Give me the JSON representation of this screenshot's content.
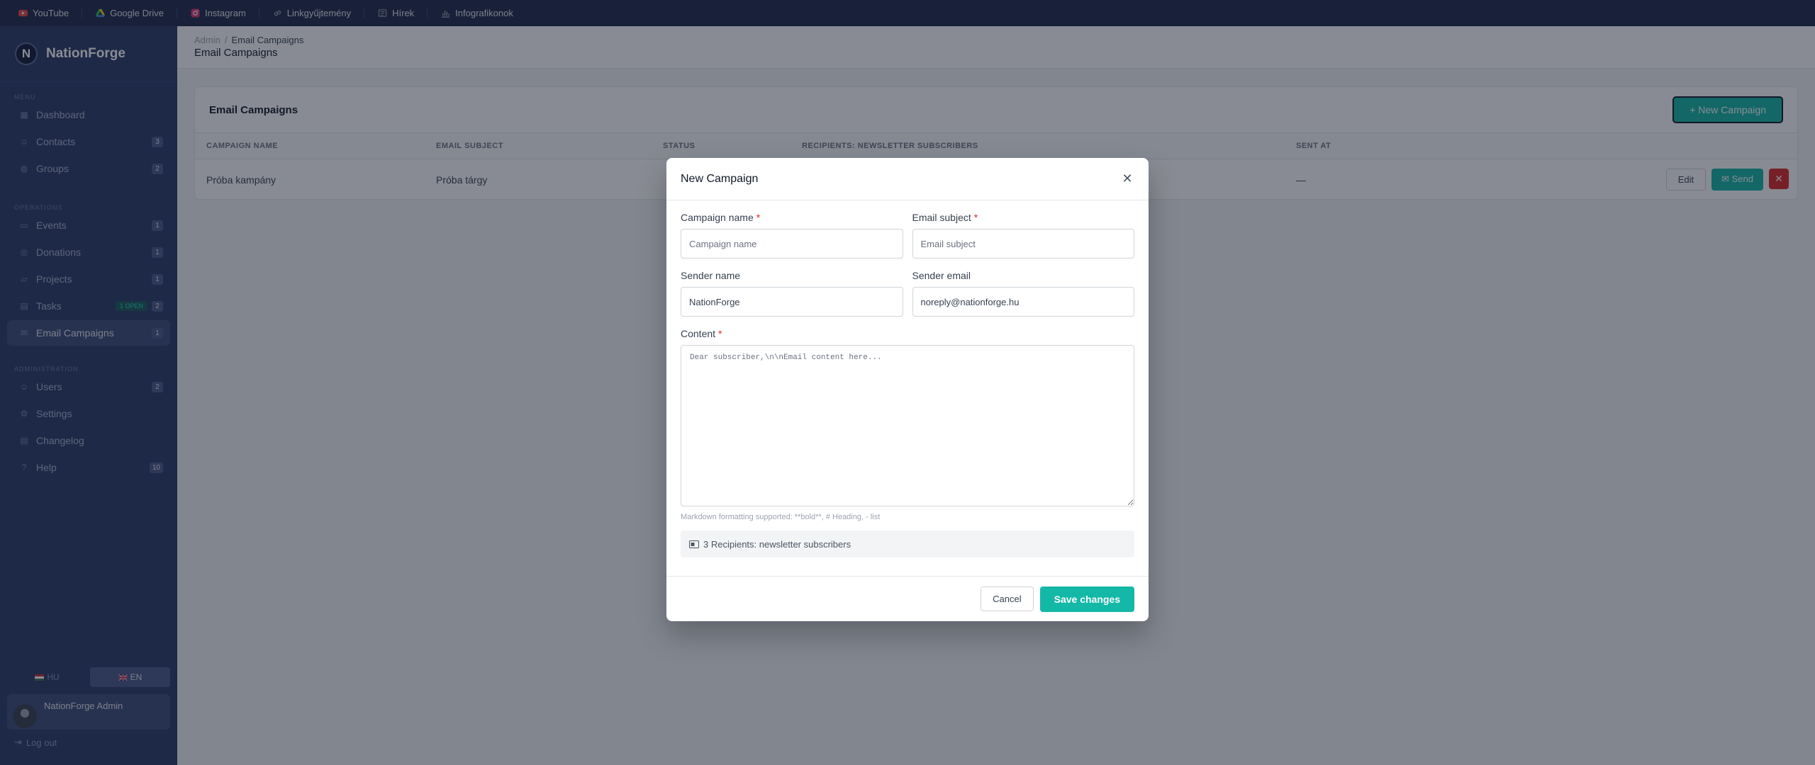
{
  "bookmarks": [
    {
      "label": "YouTube",
      "icon": "youtube-icon",
      "color": "#ef4444"
    },
    {
      "label": "Google Drive",
      "icon": "google-drive-icon",
      "color": "#22c55e"
    },
    {
      "label": "Instagram",
      "icon": "instagram-icon",
      "color": "#ec4899"
    },
    {
      "label": "Linkgyűjtemény",
      "icon": "link-icon",
      "color": "#9ca3af"
    },
    {
      "label": "Hírek",
      "icon": "newspaper-icon",
      "color": "#9ca3af"
    },
    {
      "label": "Infografikonok",
      "icon": "bar-chart-icon",
      "color": "#9ca3af"
    }
  ],
  "sidebar": {
    "brand_letter": "N",
    "brand_name": "NationForge",
    "section_menu": "MENU",
    "section_operations": "OPERATIONS",
    "section_admin": "ADMINISTRATION",
    "items": [
      {
        "label": "Dashboard",
        "count": null
      },
      {
        "label": "Contacts",
        "count": "3"
      },
      {
        "label": "Groups",
        "count": "2"
      },
      {
        "label": "Events",
        "count": "1"
      },
      {
        "label": "Donations",
        "count": "1"
      },
      {
        "label": "Projects",
        "count": "1"
      },
      {
        "label": "Tasks",
        "count": "2",
        "badge": "1 OPEN"
      },
      {
        "label": "Email Campaigns",
        "count": "1"
      },
      {
        "label": "Users",
        "count": "2"
      },
      {
        "label": "Settings",
        "count": null
      },
      {
        "label": "Changelog",
        "count": null
      },
      {
        "label": "Help",
        "count": "10"
      }
    ],
    "lang_hu": "HU",
    "lang_en": "EN",
    "user_name": "NationForge Admin",
    "logout": "Log out"
  },
  "header": {
    "crumb_root": "Admin",
    "crumb_sep": "/",
    "crumb_current": "Email Campaigns",
    "title": "Email Campaigns"
  },
  "card": {
    "title": "Email Campaigns",
    "new_button": "+ New Campaign",
    "columns": [
      "CAMPAIGN NAME",
      "EMAIL SUBJECT",
      "STATUS",
      "RECIPIENTS: NEWSLETTER SUBSCRIBERS",
      "SENT AT"
    ],
    "rows": [
      {
        "name": "Próba kampány",
        "subject": "Próba tárgy",
        "status": "",
        "recipients": "",
        "sent_at": "—"
      }
    ],
    "edit_label": "Edit",
    "send_label": "✉ Send",
    "delete_label": "✕"
  },
  "modal": {
    "title": "New Campaign",
    "close": "✕",
    "campaign_name_label": "Campaign name",
    "campaign_name_placeholder": "Campaign name",
    "email_subject_label": "Email subject",
    "email_subject_placeholder": "Email subject",
    "sender_name_label": "Sender name",
    "sender_name_value": "NationForge",
    "sender_email_label": "Sender email",
    "sender_email_value": "noreply@nationforge.hu",
    "content_label": "Content",
    "content_placeholder": "Dear subscriber,\\n\\nEmail content here...",
    "required_mark": "*",
    "hint": "Markdown formatting supported: **bold**, # Heading, - list",
    "recipients_text": "3 Recipients: newsletter subscribers",
    "cancel_label": "Cancel",
    "save_label": "Save changes"
  },
  "colors": {
    "accent": "#14b8a6",
    "danger": "#dc2626",
    "sidebar_bg": "#2b3a67",
    "topbar_bg": "#1e2a4a"
  }
}
